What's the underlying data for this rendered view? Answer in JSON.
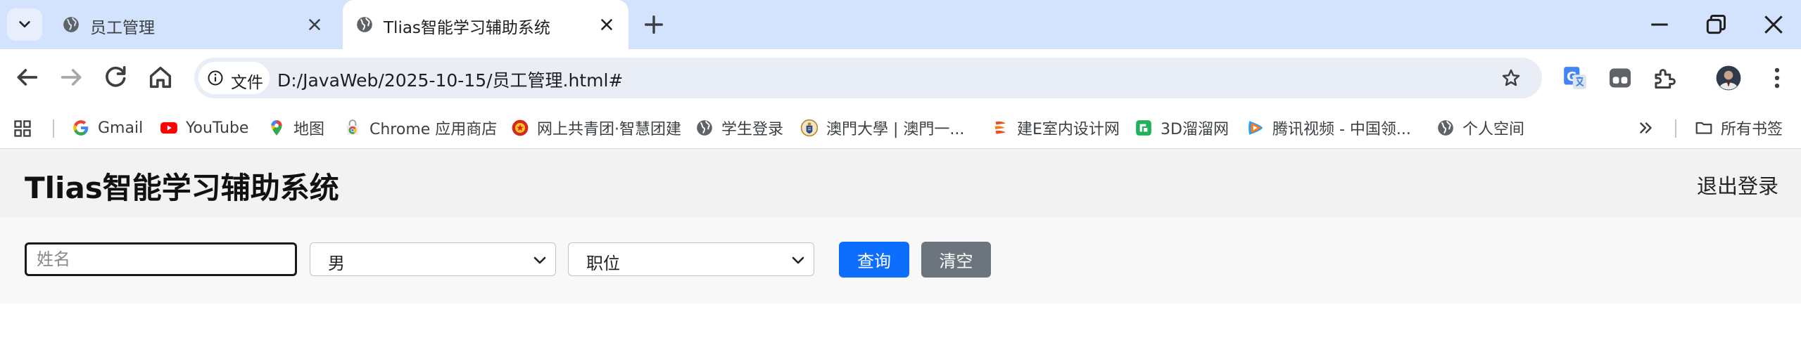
{
  "browser": {
    "tabs": [
      {
        "title": "员工管理",
        "active": false
      },
      {
        "title": "Tlias智能学习辅助系统",
        "active": true
      }
    ],
    "site_chip_label": "文件",
    "url": "D:/JavaWeb/2025-10-15/员工管理.html#",
    "bookmarks": [
      {
        "label": "Gmail",
        "icon": "google-icon"
      },
      {
        "label": "YouTube",
        "icon": "youtube-icon"
      },
      {
        "label": "地图",
        "icon": "maps-pin-icon"
      },
      {
        "label": "Chrome 应用商店",
        "icon": "chrome-webstore-icon"
      },
      {
        "label": "网上共青团·智慧团建",
        "icon": "youth-league-icon"
      },
      {
        "label": "学生登录",
        "icon": "globe-icon"
      },
      {
        "label": "澳門大學 | 澳門一...",
        "icon": "um-crest-icon"
      },
      {
        "label": "建E室内设计网",
        "icon": "jiane-logo-icon"
      },
      {
        "label": "3D溜溜网",
        "icon": "3d-liuliu-icon"
      },
      {
        "label": "腾讯视频 - 中国领...",
        "icon": "tencent-video-icon"
      },
      {
        "label": "个人空间",
        "icon": "globe-icon"
      }
    ],
    "all_bookmarks_label": "所有书签"
  },
  "app": {
    "title": "Tlias智能学习辅助系统",
    "logout_label": "退出登录"
  },
  "search": {
    "name_placeholder": "姓名",
    "gender_value": "男",
    "position_value": "职位",
    "query_label": "查询",
    "clear_label": "清空"
  },
  "colors": {
    "tabstrip": "#d3e3fd",
    "primary": "#0d6efd",
    "secondary": "#6c757d"
  }
}
